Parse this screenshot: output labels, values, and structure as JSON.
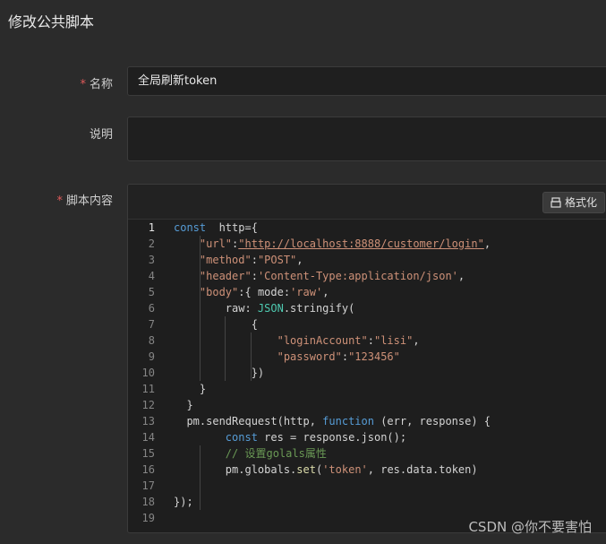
{
  "page": {
    "title": "修改公共脚本"
  },
  "form": {
    "name": {
      "required_mark": "*",
      "label": "名称",
      "value": "全局刷新token"
    },
    "description": {
      "label": "说明",
      "value": ""
    },
    "script": {
      "required_mark": "*",
      "label": "脚本内容",
      "format_button": "格式化"
    }
  },
  "code_lines": [
    {
      "n": "1",
      "parts": [
        [
          "kw",
          "const"
        ],
        [
          "",
          "  http={"
        ]
      ]
    },
    {
      "n": "2",
      "parts": [
        [
          "",
          "    "
        ],
        [
          "str",
          "\"url\""
        ],
        [
          "",
          ":"
        ],
        [
          "str url",
          "\"http://localhost:8888/customer/login\""
        ],
        [
          "",
          ","
        ]
      ]
    },
    {
      "n": "3",
      "parts": [
        [
          "",
          "    "
        ],
        [
          "str",
          "\"method\""
        ],
        [
          "",
          ":"
        ],
        [
          "str",
          "\"POST\""
        ],
        [
          "",
          ","
        ]
      ]
    },
    {
      "n": "4",
      "parts": [
        [
          "",
          "    "
        ],
        [
          "str",
          "\"header\""
        ],
        [
          "",
          ":"
        ],
        [
          "str",
          "'Content-Type:application/json'"
        ],
        [
          "",
          ","
        ]
      ]
    },
    {
      "n": "5",
      "parts": [
        [
          "",
          "    "
        ],
        [
          "str",
          "\"body\""
        ],
        [
          "",
          ":{ mode:"
        ],
        [
          "str",
          "'raw'"
        ],
        [
          "",
          ","
        ]
      ]
    },
    {
      "n": "6",
      "parts": [
        [
          "",
          "        raw: "
        ],
        [
          "obj",
          "JSON"
        ],
        [
          "",
          ".stringify("
        ]
      ]
    },
    {
      "n": "7",
      "parts": [
        [
          "",
          "            {"
        ]
      ]
    },
    {
      "n": "8",
      "parts": [
        [
          "",
          "                "
        ],
        [
          "str",
          "\"loginAccount\""
        ],
        [
          "",
          ":"
        ],
        [
          "str",
          "\"lisi\""
        ],
        [
          "",
          ","
        ]
      ]
    },
    {
      "n": "9",
      "parts": [
        [
          "",
          "                "
        ],
        [
          "str",
          "\"password\""
        ],
        [
          "",
          ":"
        ],
        [
          "str",
          "\"123456\""
        ]
      ]
    },
    {
      "n": "10",
      "parts": [
        [
          "",
          "            })"
        ]
      ]
    },
    {
      "n": "11",
      "parts": [
        [
          "",
          "    }"
        ]
      ]
    },
    {
      "n": "12",
      "parts": [
        [
          "",
          "  }"
        ]
      ]
    },
    {
      "n": "13",
      "parts": [
        [
          "",
          "  pm.sendRequest(http, "
        ],
        [
          "kw",
          "function"
        ],
        [
          "",
          " (err, response) {"
        ]
      ]
    },
    {
      "n": "14",
      "parts": [
        [
          "",
          "        "
        ],
        [
          "kw",
          "const"
        ],
        [
          "",
          " res = response.json();"
        ]
      ]
    },
    {
      "n": "15",
      "parts": [
        [
          "",
          "        "
        ],
        [
          "cm",
          "// 设置golals属性"
        ]
      ]
    },
    {
      "n": "16",
      "parts": [
        [
          "",
          "        pm.globals."
        ],
        [
          "fn",
          "set"
        ],
        [
          "",
          "("
        ],
        [
          "str",
          "'token'"
        ],
        [
          "",
          ", res.data.token)"
        ]
      ]
    },
    {
      "n": "17",
      "parts": [
        [
          "",
          ""
        ]
      ]
    },
    {
      "n": "18",
      "parts": [
        [
          "",
          "});"
        ]
      ]
    },
    {
      "n": "19",
      "parts": [
        [
          "",
          ""
        ]
      ]
    }
  ],
  "watermark": "CSDN @你不要害怕"
}
